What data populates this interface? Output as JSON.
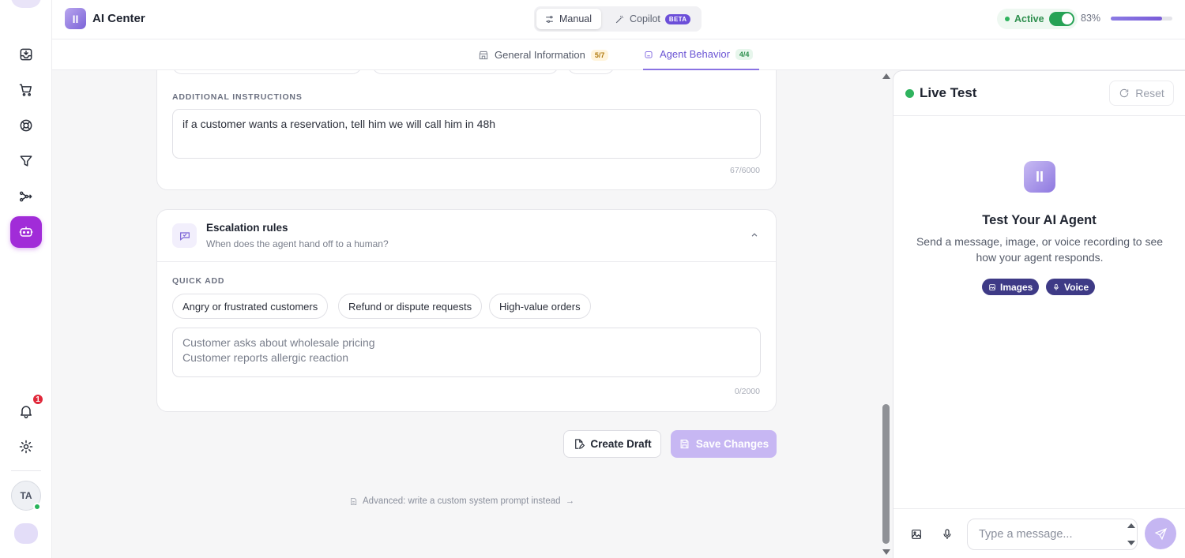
{
  "header": {
    "brand_title": "AI Center",
    "brand_logo_glyph": "II",
    "mode_manual": "Manual",
    "mode_copilot": "Copilot",
    "beta_badge": "BETA",
    "status_label": "Active",
    "status_enabled": true,
    "completion_percent_label": "83%",
    "completion_fraction": 0.83,
    "accent_color": "#8b7be4"
  },
  "tabs": [
    {
      "label": "General Information",
      "count": "5/7",
      "icon": "storefront-icon"
    },
    {
      "label": "Agent Behavior",
      "count": "4/4",
      "icon": "bot-icon",
      "active": true
    }
  ],
  "instructions": {
    "section_label": "ADDITIONAL INSTRUCTIONS",
    "value": "if a customer wants a reservation, tell him we will call him in 48h",
    "counter": "67/6000"
  },
  "escalation": {
    "title": "Escalation rules",
    "subtitle": "When does the agent hand off to a human?",
    "quick_add_label": "QUICK ADD",
    "quick_add": [
      "Angry or frustrated customers",
      "Refund or dispute requests",
      "High-value orders"
    ],
    "placeholder_line1": "Customer asks about wholesale pricing",
    "placeholder_line2": "Customer reports allergic reaction",
    "counter": "0/2000"
  },
  "actions": {
    "create_draft": "Create Draft",
    "save_changes": "Save Changes",
    "advanced_link": "Advanced: write a custom system prompt instead",
    "advanced_arrow": "→"
  },
  "sidebar": {
    "notification_count": "1",
    "avatar_initials": "TA",
    "active_item_color": "#a12cd8"
  },
  "live_test": {
    "title": "Live Test",
    "reset_label": "Reset",
    "empty_title": "Test Your AI Agent",
    "empty_desc": "Send a message, image, or voice recording to see how your agent responds.",
    "pill_images": "Images",
    "pill_voice": "Voice",
    "input_placeholder": "Type a message...",
    "logo_glyph": "II"
  }
}
